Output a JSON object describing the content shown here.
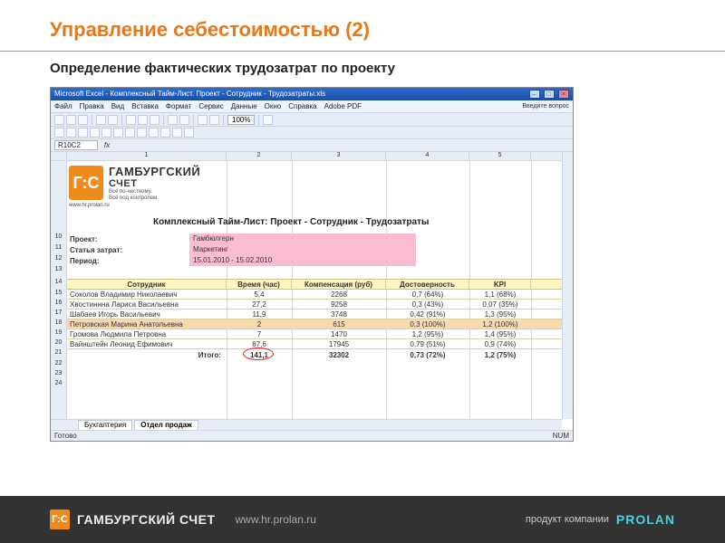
{
  "slide": {
    "title": "Управление себестоимостью (2)",
    "subtitle": "Определение фактических трудозатрат по проекту"
  },
  "window": {
    "title": "Microsoft Excel - Комплексный Тайм-Лист. Проект - Сотрудник - Трудозатраты.xls",
    "menu": [
      "Файл",
      "Правка",
      "Вид",
      "Вставка",
      "Формат",
      "Сервис",
      "Данные",
      "Окно",
      "Справка",
      "Adobe PDF"
    ],
    "help_prompt": "Введите вопрос",
    "zoom": "100%",
    "cellref": "R10C2",
    "status": "Готово",
    "status_right": "NUM",
    "tabs": [
      "Бухгалтерия",
      "Отдел продаж"
    ],
    "col_headers": [
      "1",
      "2",
      "3",
      "4",
      "5"
    ]
  },
  "logo": {
    "mark": "Г:С",
    "brand": "ГАМБУРГСКИЙ",
    "brand2": "СЧЕТ",
    "tag1": "Всё по-честному.",
    "tag2": "Всё под контролем.",
    "url": "www.hr.prolan.ru"
  },
  "doc": {
    "title_label": "Комплексный Тайм-Лист:",
    "title_value": "Проект - Сотрудник - Трудозатраты",
    "labels": {
      "project": "Проект:",
      "cost_item": "Статья затрат:",
      "period": "Период:"
    },
    "values": {
      "project": "Гамбюлгерн",
      "cost_item": "Маркетинг",
      "period": "15.01.2010 - 15.02.2010"
    }
  },
  "columns": {
    "name": "Сотрудник",
    "time": "Время (час)",
    "comp": "Компенсация (руб)",
    "reliability": "Достоверность",
    "kpi": "KPI"
  },
  "rows": [
    {
      "name": "Соколов Владимир Николаевич",
      "time": "5,4",
      "comp": "2268",
      "reliability": "0,7 (64%)",
      "kpi": "1,1 (68%)"
    },
    {
      "name": "Хвостиннна Лариса Васильевна",
      "time": "27,2",
      "comp": "9258",
      "reliability": "0,3 (43%)",
      "kpi": "0,07 (35%)"
    },
    {
      "name": "Шабаев Игорь Васильевич",
      "time": "11,9",
      "comp": "3748",
      "reliability": "0,42 (91%)",
      "kpi": "1,3 (95%)"
    },
    {
      "name": "Петровская Марина Анатольевна",
      "time": "2",
      "comp": "615",
      "reliability": "0,3 (100%)",
      "kpi": "1,2 (100%)"
    },
    {
      "name": "Громова Людмила Петровна",
      "time": "7",
      "comp": "1470",
      "reliability": "1,2 (95%)",
      "kpi": "1,4 (95%)"
    },
    {
      "name": "Вайнштейн Леонид Ефимович",
      "time": "87,6",
      "comp": "17945",
      "reliability": "0,79 (51%)",
      "kpi": "0,9 (74%)"
    }
  ],
  "total": {
    "label": "Итого:",
    "time": "141,1",
    "comp": "32302",
    "reliability": "0,73 (72%)",
    "kpi": "1,2 (75%)"
  },
  "footer": {
    "brand": "ГАМБУРГСКИЙ СЧЕТ",
    "url": "www.hr.prolan.ru",
    "product_of": "продукт компании",
    "company": "PROLAN"
  }
}
